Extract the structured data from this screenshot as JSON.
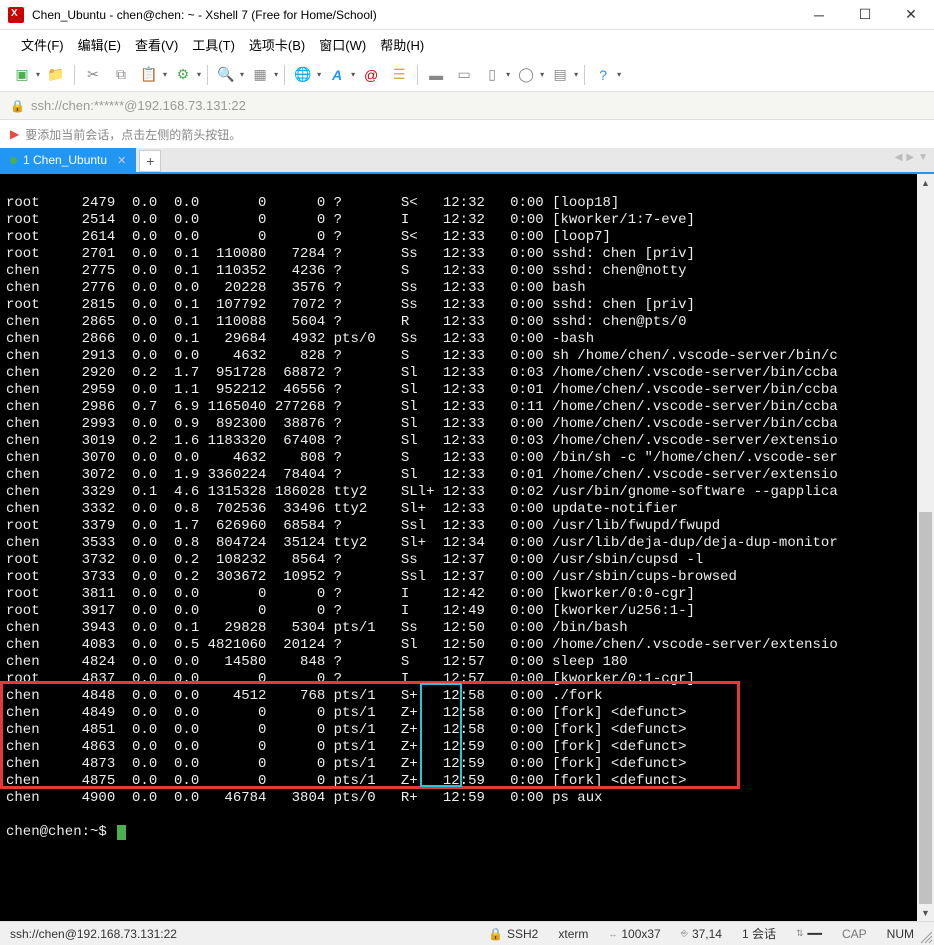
{
  "window": {
    "title": "Chen_Ubuntu - chen@chen: ~ - Xshell 7 (Free for Home/School)"
  },
  "menu": {
    "file": "文件(F)",
    "edit": "编辑(E)",
    "view": "查看(V)",
    "tools": "工具(T)",
    "tabs": "选项卡(B)",
    "window": "窗口(W)",
    "help": "帮助(H)"
  },
  "toolbar_icons": {
    "new": "new-file-icon",
    "open": "open-folder-icon",
    "scissors": "cut-icon",
    "copy": "copy-icon",
    "paste": "clipboard-icon",
    "upload": "upload-icon",
    "search": "search-icon",
    "grid": "grid-icon",
    "globe": "globe-icon",
    "font": "font-icon",
    "at": "at-icon",
    "list": "list-icon",
    "col1": "panel-left-icon",
    "col2": "panel-right-icon",
    "col3": "panel-split-icon",
    "circle": "circle-icon",
    "more": "more-icon",
    "help": "help-icon"
  },
  "addressbar": {
    "url": "ssh://chen:******@192.168.73.131:22"
  },
  "hint": {
    "text": "要添加当前会话，点击左侧的箭头按钮。"
  },
  "tab": {
    "label": "1 Chen_Ubuntu"
  },
  "tabbar": {
    "nav_left": "◀",
    "nav_right": "▶",
    "nav_menu": "▼"
  },
  "rows": [
    {
      "user": "root",
      "pid": "2479",
      "cpu": "0.0",
      "mem": "0.0",
      "vsz": "0",
      "rss": "0",
      "tty": "?",
      "stat": "S<",
      "start": "12:32",
      "time": "0:00",
      "cmd": "[loop18]"
    },
    {
      "user": "root",
      "pid": "2514",
      "cpu": "0.0",
      "mem": "0.0",
      "vsz": "0",
      "rss": "0",
      "tty": "?",
      "stat": "I",
      "start": "12:32",
      "time": "0:00",
      "cmd": "[kworker/1:7-eve]"
    },
    {
      "user": "root",
      "pid": "2614",
      "cpu": "0.0",
      "mem": "0.0",
      "vsz": "0",
      "rss": "0",
      "tty": "?",
      "stat": "S<",
      "start": "12:33",
      "time": "0:00",
      "cmd": "[loop7]"
    },
    {
      "user": "root",
      "pid": "2701",
      "cpu": "0.0",
      "mem": "0.1",
      "vsz": "110080",
      "rss": "7284",
      "tty": "?",
      "stat": "Ss",
      "start": "12:33",
      "time": "0:00",
      "cmd": "sshd: chen [priv]"
    },
    {
      "user": "chen",
      "pid": "2775",
      "cpu": "0.0",
      "mem": "0.1",
      "vsz": "110352",
      "rss": "4236",
      "tty": "?",
      "stat": "S",
      "start": "12:33",
      "time": "0:00",
      "cmd": "sshd: chen@notty"
    },
    {
      "user": "chen",
      "pid": "2776",
      "cpu": "0.0",
      "mem": "0.0",
      "vsz": "20228",
      "rss": "3576",
      "tty": "?",
      "stat": "Ss",
      "start": "12:33",
      "time": "0:00",
      "cmd": "bash"
    },
    {
      "user": "root",
      "pid": "2815",
      "cpu": "0.0",
      "mem": "0.1",
      "vsz": "107792",
      "rss": "7072",
      "tty": "?",
      "stat": "Ss",
      "start": "12:33",
      "time": "0:00",
      "cmd": "sshd: chen [priv]"
    },
    {
      "user": "chen",
      "pid": "2865",
      "cpu": "0.0",
      "mem": "0.1",
      "vsz": "110088",
      "rss": "5604",
      "tty": "?",
      "stat": "R",
      "start": "12:33",
      "time": "0:00",
      "cmd": "sshd: chen@pts/0"
    },
    {
      "user": "chen",
      "pid": "2866",
      "cpu": "0.0",
      "mem": "0.1",
      "vsz": "29684",
      "rss": "4932",
      "tty": "pts/0",
      "stat": "Ss",
      "start": "12:33",
      "time": "0:00",
      "cmd": "-bash"
    },
    {
      "user": "chen",
      "pid": "2913",
      "cpu": "0.0",
      "mem": "0.0",
      "vsz": "4632",
      "rss": "828",
      "tty": "?",
      "stat": "S",
      "start": "12:33",
      "time": "0:00",
      "cmd": "sh /home/chen/.vscode-server/bin/c"
    },
    {
      "user": "chen",
      "pid": "2920",
      "cpu": "0.2",
      "mem": "1.7",
      "vsz": "951728",
      "rss": "68872",
      "tty": "?",
      "stat": "Sl",
      "start": "12:33",
      "time": "0:03",
      "cmd": "/home/chen/.vscode-server/bin/ccba"
    },
    {
      "user": "chen",
      "pid": "2959",
      "cpu": "0.0",
      "mem": "1.1",
      "vsz": "952212",
      "rss": "46556",
      "tty": "?",
      "stat": "Sl",
      "start": "12:33",
      "time": "0:01",
      "cmd": "/home/chen/.vscode-server/bin/ccba"
    },
    {
      "user": "chen",
      "pid": "2986",
      "cpu": "0.7",
      "mem": "6.9",
      "vsz": "1165040",
      "rss": "277268",
      "tty": "?",
      "stat": "Sl",
      "start": "12:33",
      "time": "0:11",
      "cmd": "/home/chen/.vscode-server/bin/ccba"
    },
    {
      "user": "chen",
      "pid": "2993",
      "cpu": "0.0",
      "mem": "0.9",
      "vsz": "892300",
      "rss": "38876",
      "tty": "?",
      "stat": "Sl",
      "start": "12:33",
      "time": "0:00",
      "cmd": "/home/chen/.vscode-server/bin/ccba"
    },
    {
      "user": "chen",
      "pid": "3019",
      "cpu": "0.2",
      "mem": "1.6",
      "vsz": "1183320",
      "rss": "67408",
      "tty": "?",
      "stat": "Sl",
      "start": "12:33",
      "time": "0:03",
      "cmd": "/home/chen/.vscode-server/extensio"
    },
    {
      "user": "chen",
      "pid": "3070",
      "cpu": "0.0",
      "mem": "0.0",
      "vsz": "4632",
      "rss": "808",
      "tty": "?",
      "stat": "S",
      "start": "12:33",
      "time": "0:00",
      "cmd": "/bin/sh -c \"/home/chen/.vscode-ser"
    },
    {
      "user": "chen",
      "pid": "3072",
      "cpu": "0.0",
      "mem": "1.9",
      "vsz": "3360224",
      "rss": "78404",
      "tty": "?",
      "stat": "Sl",
      "start": "12:33",
      "time": "0:01",
      "cmd": "/home/chen/.vscode-server/extensio"
    },
    {
      "user": "chen",
      "pid": "3329",
      "cpu": "0.1",
      "mem": "4.6",
      "vsz": "1315328",
      "rss": "186028",
      "tty": "tty2",
      "stat": "SLl+",
      "start": "12:33",
      "time": "0:02",
      "cmd": "/usr/bin/gnome-software --gapplica"
    },
    {
      "user": "chen",
      "pid": "3332",
      "cpu": "0.0",
      "mem": "0.8",
      "vsz": "702536",
      "rss": "33496",
      "tty": "tty2",
      "stat": "Sl+",
      "start": "12:33",
      "time": "0:00",
      "cmd": "update-notifier"
    },
    {
      "user": "root",
      "pid": "3379",
      "cpu": "0.0",
      "mem": "1.7",
      "vsz": "626960",
      "rss": "68584",
      "tty": "?",
      "stat": "Ssl",
      "start": "12:33",
      "time": "0:00",
      "cmd": "/usr/lib/fwupd/fwupd"
    },
    {
      "user": "chen",
      "pid": "3533",
      "cpu": "0.0",
      "mem": "0.8",
      "vsz": "804724",
      "rss": "35124",
      "tty": "tty2",
      "stat": "Sl+",
      "start": "12:34",
      "time": "0:00",
      "cmd": "/usr/lib/deja-dup/deja-dup-monitor"
    },
    {
      "user": "root",
      "pid": "3732",
      "cpu": "0.0",
      "mem": "0.2",
      "vsz": "108232",
      "rss": "8564",
      "tty": "?",
      "stat": "Ss",
      "start": "12:37",
      "time": "0:00",
      "cmd": "/usr/sbin/cupsd -l"
    },
    {
      "user": "root",
      "pid": "3733",
      "cpu": "0.0",
      "mem": "0.2",
      "vsz": "303672",
      "rss": "10952",
      "tty": "?",
      "stat": "Ssl",
      "start": "12:37",
      "time": "0:00",
      "cmd": "/usr/sbin/cups-browsed"
    },
    {
      "user": "root",
      "pid": "3811",
      "cpu": "0.0",
      "mem": "0.0",
      "vsz": "0",
      "rss": "0",
      "tty": "?",
      "stat": "I",
      "start": "12:42",
      "time": "0:00",
      "cmd": "[kworker/0:0-cgr]"
    },
    {
      "user": "root",
      "pid": "3917",
      "cpu": "0.0",
      "mem": "0.0",
      "vsz": "0",
      "rss": "0",
      "tty": "?",
      "stat": "I",
      "start": "12:49",
      "time": "0:00",
      "cmd": "[kworker/u256:1-]"
    },
    {
      "user": "chen",
      "pid": "3943",
      "cpu": "0.0",
      "mem": "0.1",
      "vsz": "29828",
      "rss": "5304",
      "tty": "pts/1",
      "stat": "Ss",
      "start": "12:50",
      "time": "0:00",
      "cmd": "/bin/bash"
    },
    {
      "user": "chen",
      "pid": "4083",
      "cpu": "0.0",
      "mem": "0.5",
      "vsz": "4821060",
      "rss": "20124",
      "tty": "?",
      "stat": "Sl",
      "start": "12:50",
      "time": "0:00",
      "cmd": "/home/chen/.vscode-server/extensio"
    },
    {
      "user": "chen",
      "pid": "4824",
      "cpu": "0.0",
      "mem": "0.0",
      "vsz": "14580",
      "rss": "848",
      "tty": "?",
      "stat": "S",
      "start": "12:57",
      "time": "0:00",
      "cmd": "sleep 180"
    },
    {
      "user": "root",
      "pid": "4837",
      "cpu": "0.0",
      "mem": "0.0",
      "vsz": "0",
      "rss": "0",
      "tty": "?",
      "stat": "I",
      "start": "12:57",
      "time": "0:00",
      "cmd": "[kworker/0:1-cgr]"
    },
    {
      "user": "chen",
      "pid": "4848",
      "cpu": "0.0",
      "mem": "0.0",
      "vsz": "4512",
      "rss": "768",
      "tty": "pts/1",
      "stat": "S+",
      "start": "12:58",
      "time": "0:00",
      "cmd": "./fork"
    },
    {
      "user": "chen",
      "pid": "4849",
      "cpu": "0.0",
      "mem": "0.0",
      "vsz": "0",
      "rss": "0",
      "tty": "pts/1",
      "stat": "Z+",
      "start": "12:58",
      "time": "0:00",
      "cmd": "[fork] <defunct>"
    },
    {
      "user": "chen",
      "pid": "4851",
      "cpu": "0.0",
      "mem": "0.0",
      "vsz": "0",
      "rss": "0",
      "tty": "pts/1",
      "stat": "Z+",
      "start": "12:58",
      "time": "0:00",
      "cmd": "[fork] <defunct>"
    },
    {
      "user": "chen",
      "pid": "4863",
      "cpu": "0.0",
      "mem": "0.0",
      "vsz": "0",
      "rss": "0",
      "tty": "pts/1",
      "stat": "Z+",
      "start": "12:59",
      "time": "0:00",
      "cmd": "[fork] <defunct>"
    },
    {
      "user": "chen",
      "pid": "4873",
      "cpu": "0.0",
      "mem": "0.0",
      "vsz": "0",
      "rss": "0",
      "tty": "pts/1",
      "stat": "Z+",
      "start": "12:59",
      "time": "0:00",
      "cmd": "[fork] <defunct>"
    },
    {
      "user": "chen",
      "pid": "4875",
      "cpu": "0.0",
      "mem": "0.0",
      "vsz": "0",
      "rss": "0",
      "tty": "pts/1",
      "stat": "Z+",
      "start": "12:59",
      "time": "0:00",
      "cmd": "[fork] <defunct>"
    },
    {
      "user": "chen",
      "pid": "4900",
      "cpu": "0.0",
      "mem": "0.0",
      "vsz": "46784",
      "rss": "3804",
      "tty": "pts/0",
      "stat": "R+",
      "start": "12:59",
      "time": "0:00",
      "cmd": "ps aux"
    }
  ],
  "prompt": {
    "text": "chen@chen:~$ "
  },
  "status": {
    "conn": "ssh://chen@192.168.73.131:22",
    "ssh": "SSH2",
    "term": "xterm",
    "size": "100x37",
    "pos": "37,14",
    "sessions": "1 会话",
    "cap": "CAP",
    "num": "NUM"
  }
}
